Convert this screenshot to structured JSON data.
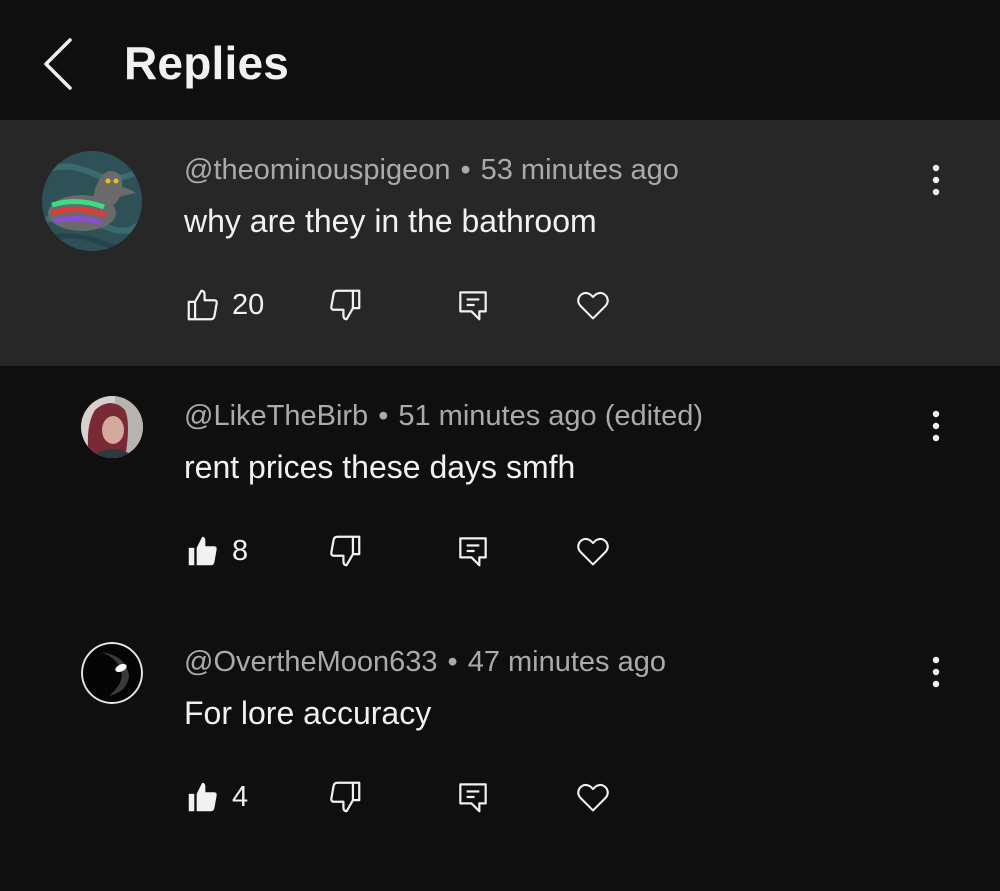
{
  "header": {
    "title": "Replies"
  },
  "comments": [
    {
      "author": "@theominouspigeon",
      "separator": "•",
      "time": "53 minutes ago",
      "text": "why are they in the bathroom",
      "likes": "20",
      "liked": false
    },
    {
      "author": "@LikeTheBirb",
      "separator": "•",
      "time": "51 minutes ago (edited)",
      "text": "rent prices these days smfh",
      "likes": "8",
      "liked": true
    },
    {
      "author": "@OvertheMoon633",
      "separator": "•",
      "time": "47 minutes ago",
      "text": "For lore accuracy",
      "likes": "4",
      "liked": true
    }
  ],
  "icons": {
    "back": "chevron-left-icon",
    "like": "thumbs-up-icon",
    "dislike": "thumbs-down-icon",
    "reply": "comment-icon",
    "heart": "heart-icon",
    "more": "more-vertical-icon"
  },
  "colors": {
    "background": "#0f0f0f",
    "highlight": "#272727",
    "primary_text": "#f1f1f1",
    "secondary_text": "#aaaaaa"
  }
}
